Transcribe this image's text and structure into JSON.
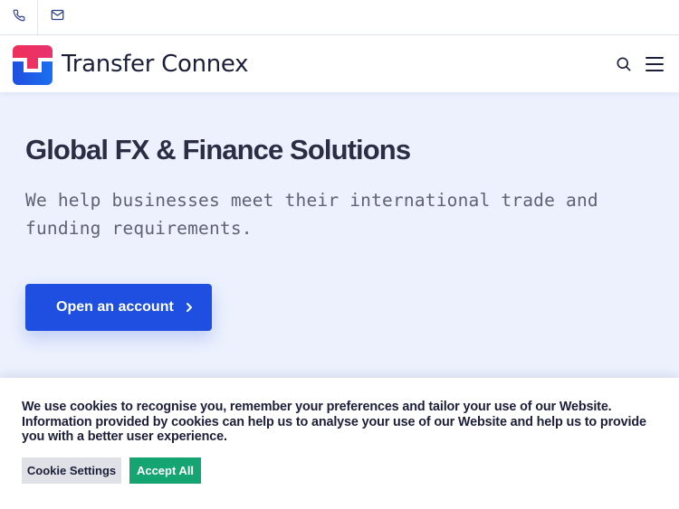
{
  "topbar": {
    "phone_icon": "phone-icon",
    "email_icon": "mail-icon"
  },
  "header": {
    "brand": "Transfer Connex",
    "search_icon": "search-icon",
    "menu_icon": "hamburger-menu-icon",
    "colors": {
      "logo_top": "#ef2f5a",
      "logo_bottom": "#1f4fe0",
      "brand_text": "#1c1f3a"
    }
  },
  "hero": {
    "title": "Global FX & Finance Solutions",
    "subtitle": "We help businesses meet their international trade and funding requirements.",
    "cta_label": "Open an account",
    "cta_icon": "chevron-right-icon",
    "colors": {
      "background": "#ecf1fd",
      "cta": "#1f4fe0"
    }
  },
  "cookie_banner": {
    "message": "We use cookies to recognise you, remember your preferences and tailor your use of our Website. Information provided by cookies can help us to analyse your use of our Website and help us to provide you with a better user experience.",
    "settings_label": "Cookie Settings",
    "accept_label": "Accept All",
    "colors": {
      "accept": "#14a572",
      "settings": "#dfe1e6"
    }
  }
}
